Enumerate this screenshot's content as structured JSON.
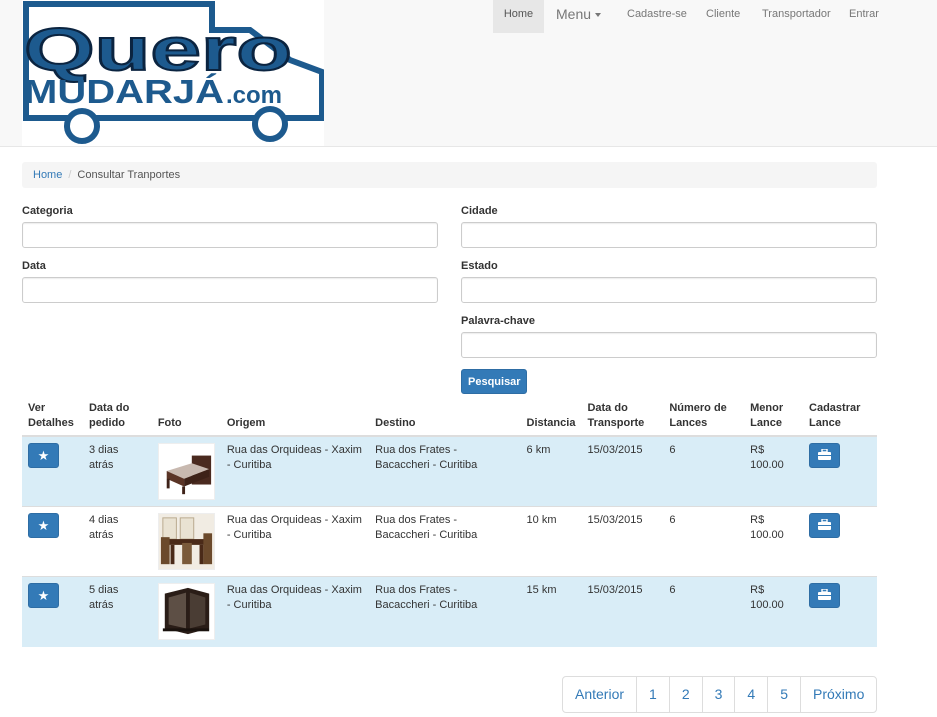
{
  "brand": {
    "logo_line1": "Quero",
    "logo_line2": "MUDARJÁ",
    "logo_suffix": ".com",
    "logo_color": "#1d5a8e"
  },
  "nav": {
    "items": [
      {
        "label": "Home",
        "active": true
      },
      {
        "label": "Menu",
        "dropdown": true
      },
      {
        "label": "Cadastre-se"
      },
      {
        "label": "Cliente"
      },
      {
        "label": "Transportador"
      },
      {
        "label": "Entrar"
      }
    ]
  },
  "breadcrumb": {
    "home": "Home",
    "separator": "/",
    "current": "Consultar Tranportes"
  },
  "form": {
    "categoria_label": "Categoria",
    "data_label": "Data",
    "cidade_label": "Cidade",
    "estado_label": "Estado",
    "palavra_label": "Palavra-chave",
    "categoria_value": "",
    "data_value": "",
    "cidade_value": "",
    "estado_value": "",
    "palavra_value": "",
    "submit_label": "Pesquisar"
  },
  "table": {
    "headers": [
      "Ver Detalhes",
      "Data do pedido",
      "Foto",
      "Origem",
      "Destino",
      "Distancia",
      "Data do Transporte",
      "Número de Lances",
      "Menor Lance",
      "Cadastrar Lance"
    ],
    "rows": [
      {
        "pedido": "3 dias atrás",
        "foto": "bed-photo",
        "origem": "Rua das Orquideas - Xaxim - Curitiba",
        "destino": "Rua dos Frates - Bacaccheri - Curitiba",
        "distancia": "6 km",
        "data_transporte": "15/03/2015",
        "lances": "6",
        "menor_lance": "R$ 100.00"
      },
      {
        "pedido": "4 dias atrás",
        "foto": "dining-set-photo",
        "origem": "Rua das Orquideas - Xaxim - Curitiba",
        "destino": "Rua dos Frates - Bacaccheri - Curitiba",
        "distancia": "10 km",
        "data_transporte": "15/03/2015",
        "lances": "6",
        "menor_lance": "R$ 100.00"
      },
      {
        "pedido": "5 dias atrás",
        "foto": "corner-cabinet-photo",
        "origem": "Rua das Orquideas - Xaxim - Curitiba",
        "destino": "Rua dos Frates - Bacaccheri - Curitiba",
        "distancia": "15 km",
        "data_transporte": "15/03/2015",
        "lances": "6",
        "menor_lance": "R$ 100.00"
      }
    ],
    "details_icon": "star-icon",
    "bid_icon": "briefcase-icon",
    "highlight_color": "#d9edf7"
  },
  "pagination": {
    "previous": "Anterior",
    "pages": [
      "1",
      "2",
      "3",
      "4",
      "5"
    ],
    "next": "Próximo"
  }
}
